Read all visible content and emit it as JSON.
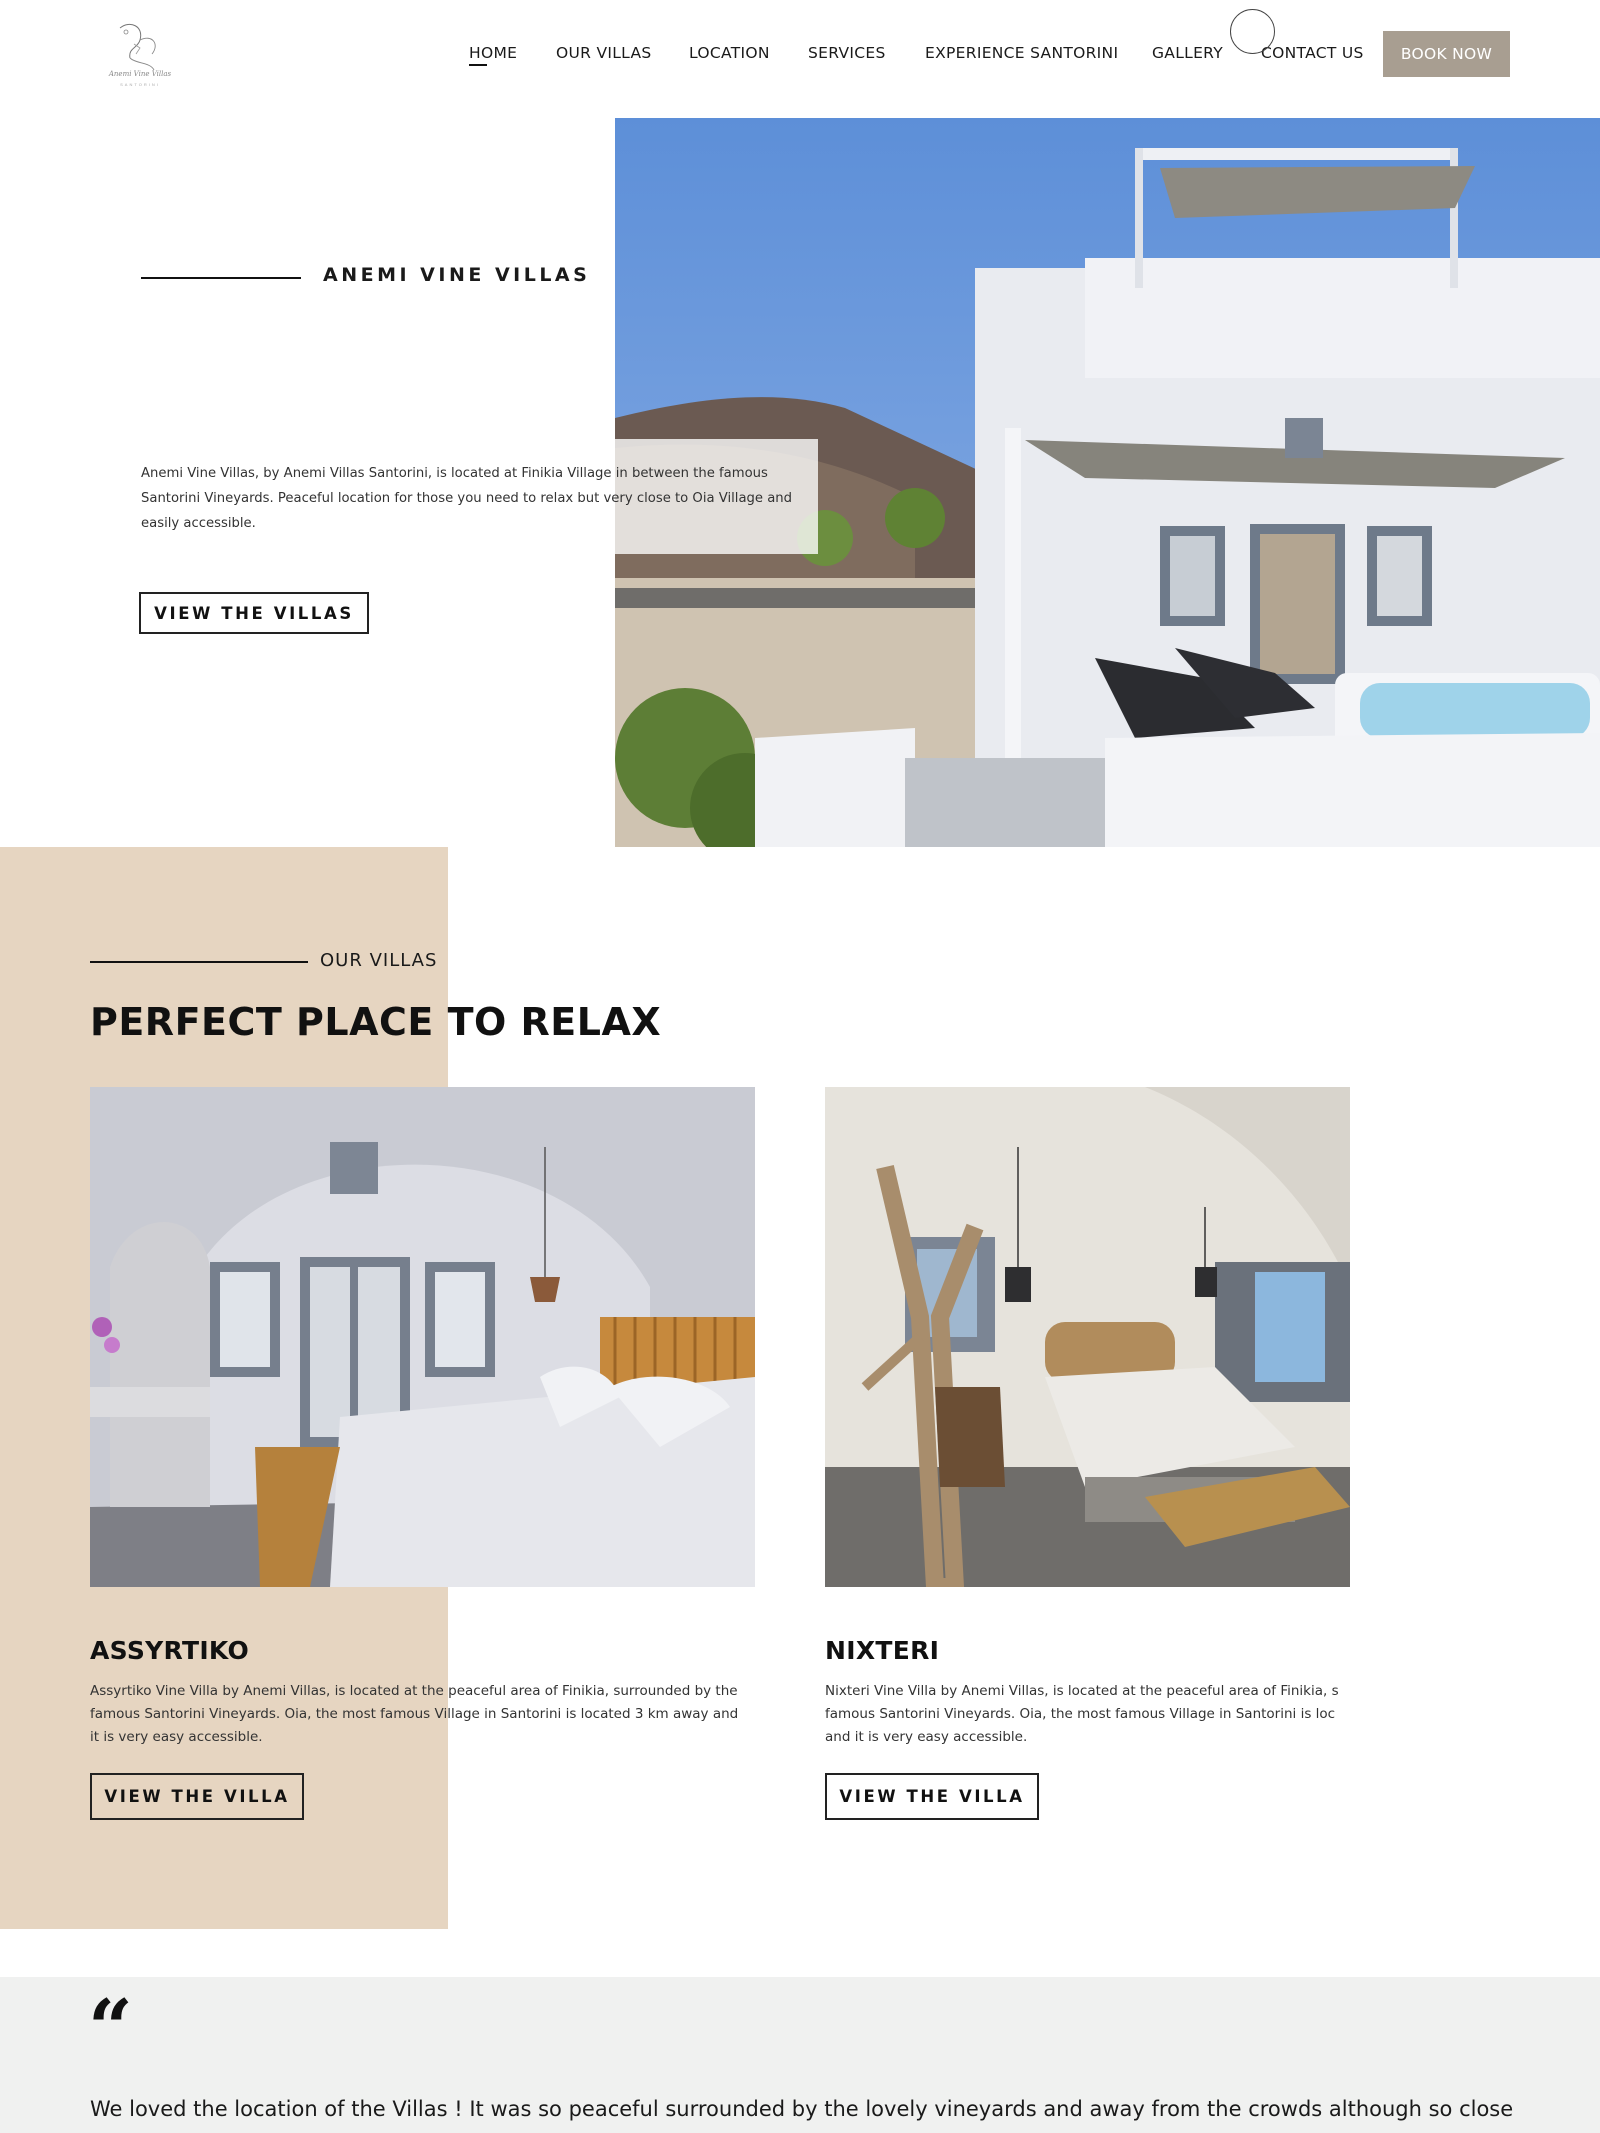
{
  "header": {
    "logo_text": "Anemi Vine Villas",
    "logo_subtext": "SANTORINI",
    "nav": [
      {
        "label": "HOME",
        "active": true
      },
      {
        "label": "OUR VILLAS",
        "active": false
      },
      {
        "label": "LOCATION",
        "active": false
      },
      {
        "label": "SERVICES",
        "active": false
      },
      {
        "label": "EXPERIENCE SANTORINI",
        "active": false
      },
      {
        "label": "GALLERY",
        "active": false
      },
      {
        "label": "CONTACT US",
        "active": false
      }
    ],
    "book_now": "BOOK NOW"
  },
  "hero": {
    "title": "ANEMI VINE VILLAS",
    "description": "Anemi Vine Villas, by Anemi Villas Santorini, is located at Finikia Village in between the famous Santorini Vineyards. Peaceful location for those you need to relax but very close to Oia Village and easily accessible.",
    "button": "VIEW THE VILLAS"
  },
  "villas": {
    "eyebrow": "OUR VILLAS",
    "heading": "PERFECT PLACE TO RELAX",
    "items": [
      {
        "name": "ASSYRTIKO",
        "description": "Assyrtiko Vine Villa by Anemi Villas, is located at the peaceful area of Finikia, surrounded by the famous Santorini Vineyards. Oia, the most famous Village in Santorini is located 3 km away and it is very easy accessible.",
        "button": "VIEW THE VILLA"
      },
      {
        "name": "NIXTERI",
        "description": "Nixteri Vine Villa by Anemi Villas, is located at the peaceful area of Finikia, s\nfamous Santorini Vineyards. Oia, the most famous Village in Santorini is loc\nand it is very easy accessible.",
        "button": "VIEW THE VILLA"
      }
    ]
  },
  "testimonial": {
    "quote_mark": "“",
    "text": "We loved the location of the Villas ! It was so peaceful surrounded by the lovely vineyards and away from the crowds although so close to Oia ."
  },
  "colors": {
    "beige_block": "#e6d5c1",
    "book_button": "#a89e91",
    "testimonial_bg": "#f0f1f0"
  }
}
